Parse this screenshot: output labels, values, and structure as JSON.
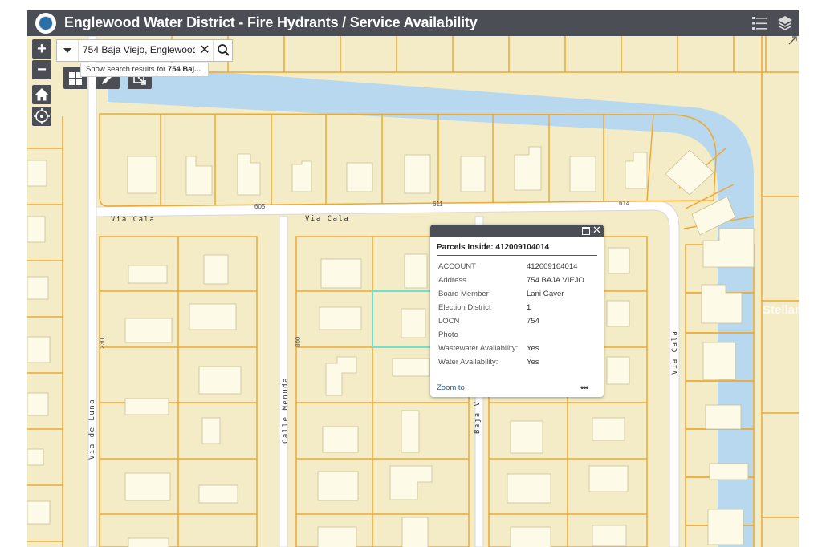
{
  "app": {
    "title": "Englewood Water District - Fire Hydrants / Service Availability",
    "icons": [
      "legend-list-icon",
      "layers-icon",
      "expand-icon"
    ]
  },
  "search": {
    "value": "754 Baja Viejo, Englewood,",
    "suggestion_prefix": "Show search results for ",
    "suggestion_term": "754 Baj..."
  },
  "controls": {
    "zoom_in": "+",
    "zoom_out": "−"
  },
  "map": {
    "streets": [
      "Via Cala",
      "Via Cala",
      "Via de Luna",
      "Calle Menuda",
      "Baja V",
      "Via Cala"
    ],
    "numbers": [
      "605",
      "611",
      "614",
      "230",
      "800"
    ],
    "colors": {
      "parcel_fill": "#f4ecc6",
      "parcel_line": "#f0a830",
      "water": "#b8d8ef",
      "road": "#ffffff",
      "building": "#fdfbe8",
      "selected": "#6fe0d0"
    }
  },
  "popup": {
    "title": "Parcels Inside: 412009104014",
    "rows": [
      {
        "key": "ACCOUNT",
        "value": "412009104014"
      },
      {
        "key": "Address",
        "value": "754 BAJA VIEJO"
      },
      {
        "key": "Board Member",
        "value": "Lani Gaver"
      },
      {
        "key": "Election District",
        "value": "1"
      },
      {
        "key": "LOCN",
        "value": "754"
      },
      {
        "key": "Photo",
        "value": ""
      },
      {
        "key": "Wastewater Availability:",
        "value": "Yes"
      },
      {
        "key": "Water Availability:",
        "value": "Yes"
      }
    ],
    "zoom_to": "Zoom to",
    "more": "•••"
  },
  "watermark": "Stellar MLS"
}
